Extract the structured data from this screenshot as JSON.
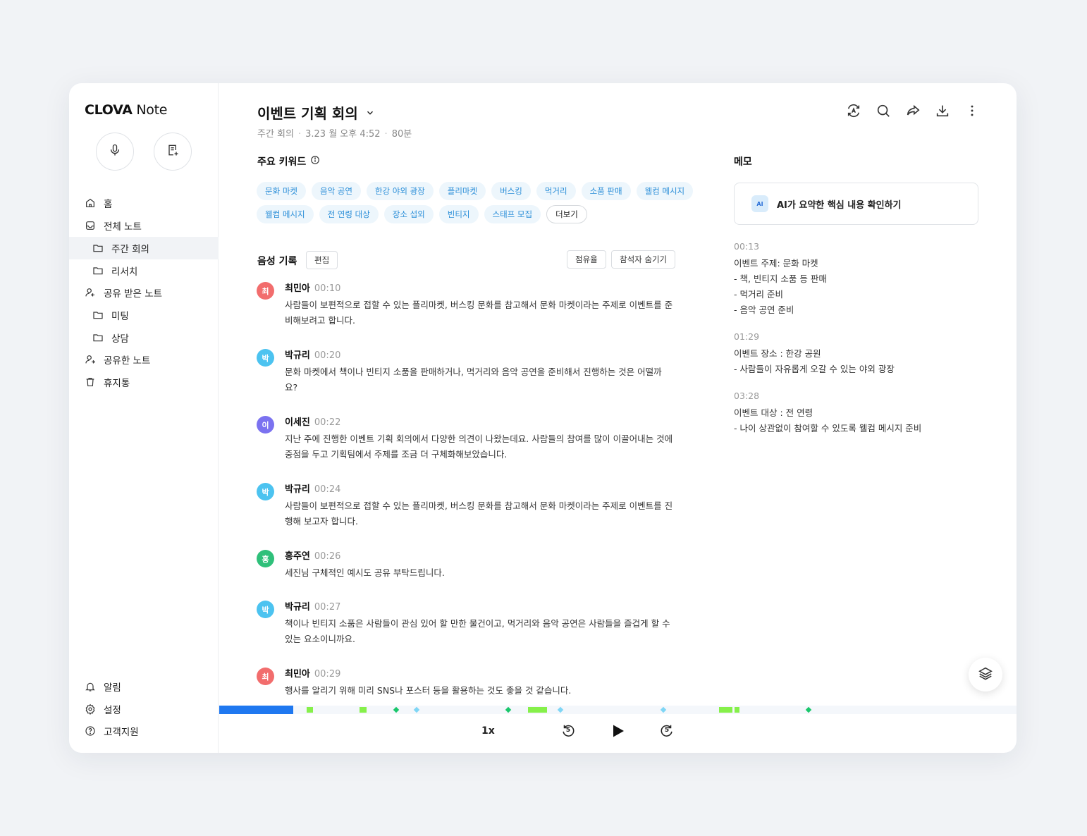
{
  "app": {
    "logo_bold": "CLOVA",
    "logo_rest": " Note"
  },
  "sidebar": {
    "items": [
      {
        "label": "홈"
      },
      {
        "label": "전체 노트"
      },
      {
        "label": "주간 회의"
      },
      {
        "label": "리서치"
      },
      {
        "label": "공유 받은 노트"
      },
      {
        "label": "미팅"
      },
      {
        "label": "상담"
      },
      {
        "label": "공유한 노트"
      },
      {
        "label": "휴지통"
      }
    ],
    "bottom": [
      {
        "label": "알림"
      },
      {
        "label": "설정"
      },
      {
        "label": "고객지원"
      }
    ]
  },
  "note": {
    "title": "이벤트 기획 회의",
    "folder": "주간 회의",
    "datetime": "3.23 월 오후 4:52",
    "duration": "80분"
  },
  "keywords": {
    "title": "주요 키워드",
    "items": [
      "문화 마켓",
      "음악 공연",
      "한강 야외 광장",
      "플리마켓",
      "버스킹",
      "먹거리",
      "소품 판매",
      "웰컴 메시지",
      "웰컴 메시지",
      "전 연령 대상",
      "장소 섭외",
      "빈티지",
      "스태프 모집"
    ],
    "more_label": "더보기"
  },
  "transcript": {
    "title": "음성 기록",
    "edit_label": "편집",
    "share_ratio_label": "점유율",
    "hide_participants_label": "참석자 숨기기",
    "entries": [
      {
        "initial": "최",
        "name": "최민아",
        "time": "00:10",
        "color": "#f26d6d",
        "text": "사람들이 보편적으로 접할 수 있는 플리마켓, 버스킹 문화를 참고해서 문화 마켓이라는 주제로 이벤트를 준비해보려고 합니다."
      },
      {
        "initial": "박",
        "name": "박규리",
        "time": "00:20",
        "color": "#4cc3f0",
        "text": "문화 마켓에서 책이나 빈티지 소품을 판매하거나, 먹거리와 음악 공연을 준비해서 진행하는 것은 어떨까요?"
      },
      {
        "initial": "이",
        "name": "이세진",
        "time": "00:22",
        "color": "#7b72f0",
        "text": "지난 주에 진행한 이벤트 기획 회의에서 다양한 의견이 나왔는데요. 사람들의 참여를 많이 이끌어내는 것에 중점을 두고 기획팀에서 주제를 조금 더 구체화해보았습니다."
      },
      {
        "initial": "박",
        "name": "박규리",
        "time": "00:24",
        "color": "#4cc3f0",
        "text": "사람들이 보편적으로 접할 수 있는 플리마켓, 버스킹 문화를 참고해서 문화 마켓이라는 주제로 이벤트를 진행해 보고자 합니다."
      },
      {
        "initial": "홍",
        "name": "홍주연",
        "time": "00:26",
        "color": "#2fc07a",
        "text": "세진님 구체적인 예시도 공유 부탁드립니다."
      },
      {
        "initial": "박",
        "name": "박규리",
        "time": "00:27",
        "color": "#4cc3f0",
        "text": "책이나 빈티지 소품은 사람들이 관심 있어 할 만한 물건이고, 먹거리와 음악 공연은 사람들을 즐겁게 할 수 있는 요소이니까요."
      },
      {
        "initial": "최",
        "name": "최민아",
        "time": "00:29",
        "color": "#f26d6d",
        "text": "행사를 알리기 위해 미리 SNS나 포스터 등을 활용하는 것도 좋을 것 같습니다."
      }
    ]
  },
  "memo": {
    "title": "메모",
    "ai_badge": "AI",
    "ai_label": "AI가 요약한 핵심 내용 확인하기",
    "blocks": [
      {
        "time": "00:13",
        "lines": [
          "이벤트 주제: 문화 마켓",
          "- 책, 빈티지 소품 등 판매",
          "- 먹거리 준비",
          "- 음악 공연 준비"
        ]
      },
      {
        "time": "01:29",
        "lines": [
          "이벤트 장소 : 한강 공원",
          "- 사람들이 자유롭게 오갈 수 있는 야외 광장"
        ]
      },
      {
        "time": "03:28",
        "lines": [
          "이벤트 대상 : 전 연령",
          "- 나이 상관없이 참여할 수 있도록 웰컴 메시지 준비"
        ]
      }
    ]
  },
  "player": {
    "speed": "1x",
    "skip_back": "5",
    "skip_forward": "5",
    "progress": 0.093
  },
  "colors": {
    "accent": "#1f78f0",
    "chip_text": "#2a8ed8",
    "chip_bg": "#edf6fc",
    "marker_green": "#86f04a",
    "marker_teal": "#19c76b",
    "marker_cyan": "#7fd6f5"
  }
}
